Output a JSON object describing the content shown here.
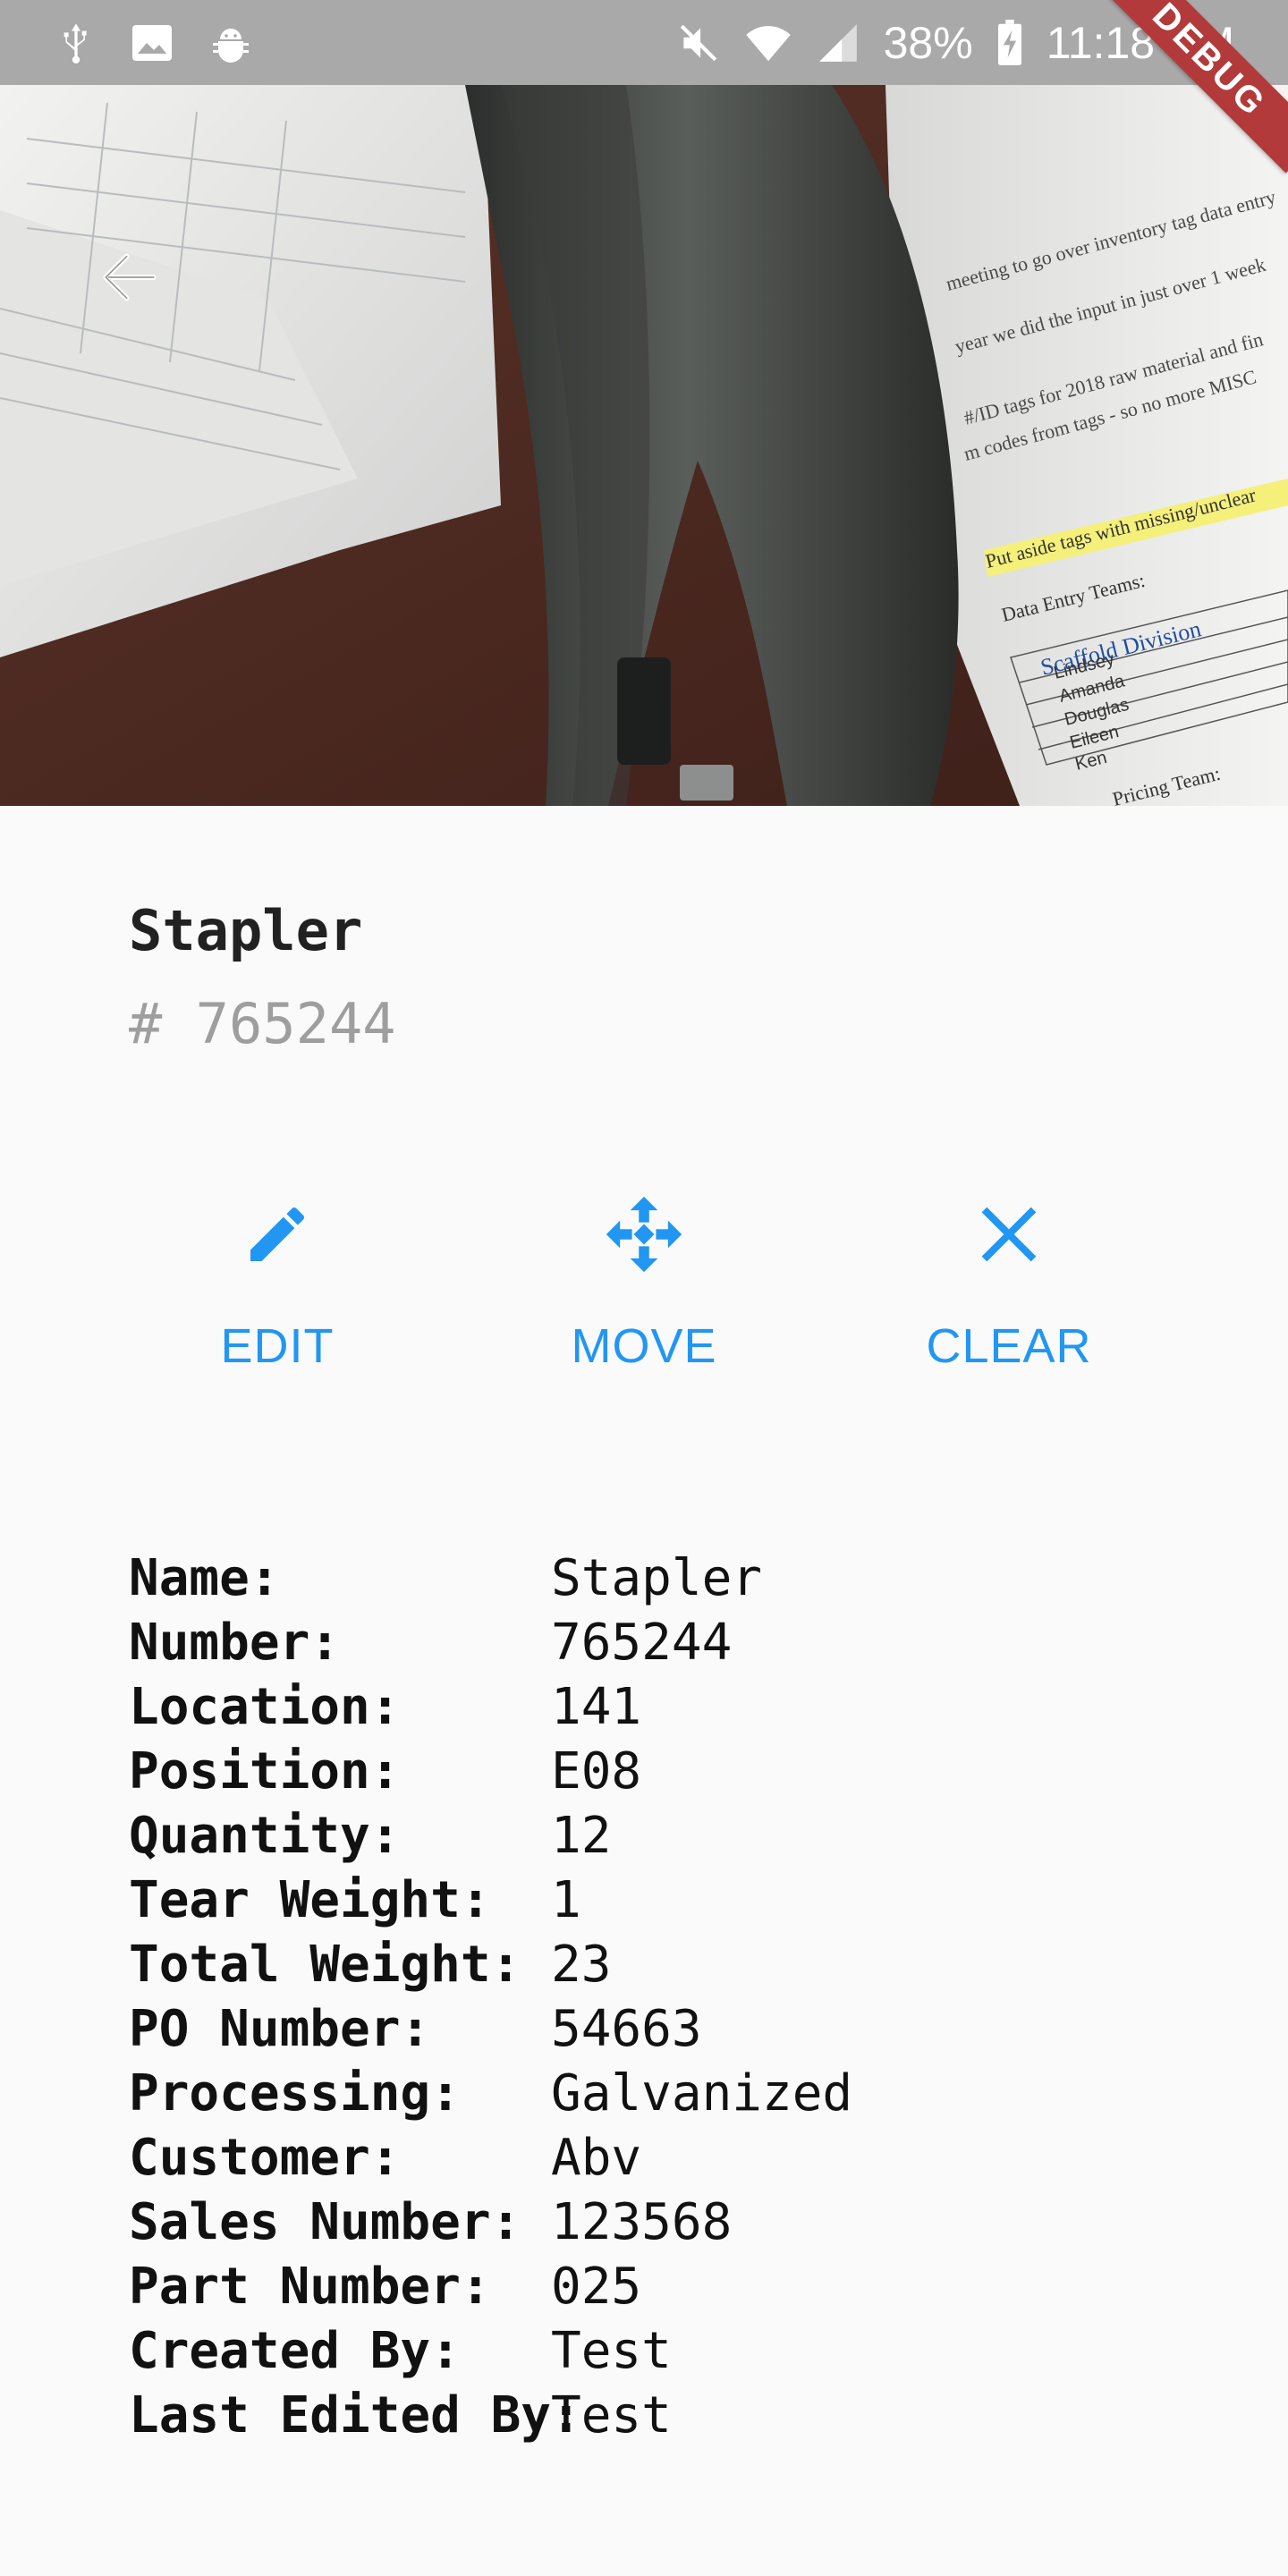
{
  "status_bar": {
    "left_icons": [
      "usb-icon",
      "image-icon",
      "android-debug-icon"
    ],
    "battery": "38%",
    "time": "11:18 PM",
    "right_icons": [
      "mute-icon",
      "wifi-icon",
      "signal-icon",
      "battery-charging-icon"
    ]
  },
  "debug_banner": "DEBUG",
  "hero": {
    "back_icon": "arrow-back-icon",
    "document_lines": [
      "Put aside tags with missing/unclear",
      "Data Entry Teams:",
      "Scaffold Division",
      "Lindsey",
      "Amanda",
      "Douglas",
      "Eileen",
      "Ken",
      "Pricing Team:",
      "Scaffold"
    ]
  },
  "item": {
    "title": "Stapler",
    "number": "# 765244"
  },
  "actions": [
    {
      "label": "EDIT",
      "icon": "edit-pencil-icon"
    },
    {
      "label": "MOVE",
      "icon": "move-arrows-icon"
    },
    {
      "label": "CLEAR",
      "icon": "close-icon"
    }
  ],
  "details": [
    {
      "key": "Name:",
      "value": "Stapler"
    },
    {
      "key": "Number:",
      "value": "765244"
    },
    {
      "key": "Location:",
      "value": "141"
    },
    {
      "key": "Position:",
      "value": "E08"
    },
    {
      "key": "Quantity:",
      "value": "12"
    },
    {
      "key": "Tear Weight:",
      "value": "1"
    },
    {
      "key": "Total Weight:",
      "value": "23"
    },
    {
      "key": "PO Number:",
      "value": "54663"
    },
    {
      "key": "Processing:",
      "value": "Galvanized"
    },
    {
      "key": "Customer:",
      "value": "Abv"
    },
    {
      "key": "Sales Number:",
      "value": "123568"
    },
    {
      "key": "Part Number:",
      "value": "025"
    },
    {
      "key": "Created By:",
      "value": "Test"
    },
    {
      "key": "Last Edited By:",
      "value": "Test"
    }
  ],
  "colors": {
    "accent": "#2196f3",
    "status_bar": "#a9a9a9",
    "debug_ribbon": "#b33a3a",
    "muted_text": "#9e9e9e"
  }
}
